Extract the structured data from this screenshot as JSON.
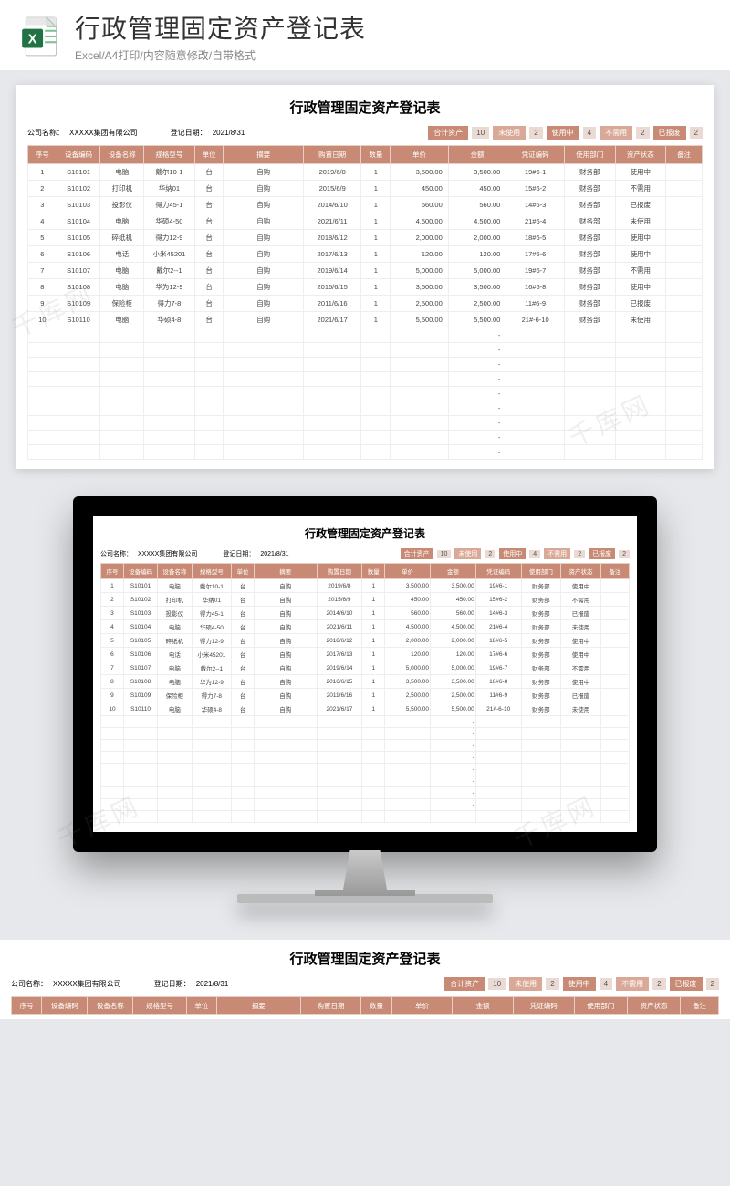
{
  "header": {
    "title": "行政管理固定资产登记表",
    "subtitle": "Excel/A4打印/内容随意修改/自带格式",
    "icon_name": "excel-icon"
  },
  "sheet": {
    "title": "行政管理固定资产登记表",
    "company_label": "公司名称：",
    "company_value": "XXXXX集团有限公司",
    "date_label": "登记日期：",
    "date_value": "2021/8/31",
    "stats": {
      "total_label": "合计资产",
      "total_value": "10",
      "unused_label": "未使用",
      "unused_value": "2",
      "inuse_label": "使用中",
      "inuse_value": "4",
      "nouse_label": "不需用",
      "nouse_value": "2",
      "scrap_label": "已报废",
      "scrap_value": "2"
    },
    "columns": [
      "序号",
      "设备编码",
      "设备名称",
      "规格型号",
      "单位",
      "摘要",
      "购置日期",
      "数量",
      "单价",
      "金额",
      "凭证编码",
      "使用部门",
      "资产状态",
      "备注"
    ],
    "rows": [
      {
        "seq": "1",
        "code": "S10101",
        "name": "电脑",
        "model": "戴尔10-1",
        "unit": "台",
        "summary": "自购",
        "date": "2019/6/8",
        "qty": "1",
        "price": "3,500.00",
        "amount": "3,500.00",
        "voucher": "19#6-1",
        "dept": "财务部",
        "status": "使用中",
        "remark": ""
      },
      {
        "seq": "2",
        "code": "S10102",
        "name": "打印机",
        "model": "华纳01",
        "unit": "台",
        "summary": "自购",
        "date": "2015/6/9",
        "qty": "1",
        "price": "450.00",
        "amount": "450.00",
        "voucher": "15#6-2",
        "dept": "财务部",
        "status": "不需用",
        "remark": ""
      },
      {
        "seq": "3",
        "code": "S10103",
        "name": "投影仪",
        "model": "得力45-1",
        "unit": "台",
        "summary": "自购",
        "date": "2014/6/10",
        "qty": "1",
        "price": "560.00",
        "amount": "560.00",
        "voucher": "14#6-3",
        "dept": "财务部",
        "status": "已报废",
        "remark": ""
      },
      {
        "seq": "4",
        "code": "S10104",
        "name": "电脑",
        "model": "华硕4-50",
        "unit": "台",
        "summary": "自购",
        "date": "2021/6/11",
        "qty": "1",
        "price": "4,500.00",
        "amount": "4,500.00",
        "voucher": "21#6-4",
        "dept": "财务部",
        "status": "未使用",
        "remark": ""
      },
      {
        "seq": "5",
        "code": "S10105",
        "name": "碎纸机",
        "model": "得力12-9",
        "unit": "台",
        "summary": "自购",
        "date": "2018/6/12",
        "qty": "1",
        "price": "2,000.00",
        "amount": "2,000.00",
        "voucher": "18#6-5",
        "dept": "财务部",
        "status": "使用中",
        "remark": ""
      },
      {
        "seq": "6",
        "code": "S10106",
        "name": "电话",
        "model": "小米45201",
        "unit": "台",
        "summary": "自购",
        "date": "2017/6/13",
        "qty": "1",
        "price": "120.00",
        "amount": "120.00",
        "voucher": "17#6-6",
        "dept": "财务部",
        "status": "使用中",
        "remark": ""
      },
      {
        "seq": "7",
        "code": "S10107",
        "name": "电脑",
        "model": "戴尔2--1",
        "unit": "台",
        "summary": "自购",
        "date": "2019/6/14",
        "qty": "1",
        "price": "5,000.00",
        "amount": "5,000.00",
        "voucher": "19#6-7",
        "dept": "财务部",
        "status": "不需用",
        "remark": ""
      },
      {
        "seq": "8",
        "code": "S10108",
        "name": "电脑",
        "model": "华为12-9",
        "unit": "台",
        "summary": "自购",
        "date": "2016/6/15",
        "qty": "1",
        "price": "3,500.00",
        "amount": "3,500.00",
        "voucher": "16#6-8",
        "dept": "财务部",
        "status": "使用中",
        "remark": ""
      },
      {
        "seq": "9",
        "code": "S10109",
        "name": "保险柜",
        "model": "得力7-8",
        "unit": "台",
        "summary": "自购",
        "date": "2011/6/16",
        "qty": "1",
        "price": "2,500.00",
        "amount": "2,500.00",
        "voucher": "11#6-9",
        "dept": "财务部",
        "status": "已报废",
        "remark": ""
      },
      {
        "seq": "10",
        "code": "S10110",
        "name": "电脑",
        "model": "华硕4-8",
        "unit": "台",
        "summary": "自购",
        "date": "2021/6/17",
        "qty": "1",
        "price": "5,500.00",
        "amount": "5,500.00",
        "voucher": "21#-6-10",
        "dept": "财务部",
        "status": "未使用",
        "remark": ""
      }
    ]
  },
  "watermark_text": "千库网",
  "colors": {
    "header_bg": "#c88a74",
    "stat_val_bg": "#eadad3",
    "page_bg": "#e6e8eb"
  }
}
